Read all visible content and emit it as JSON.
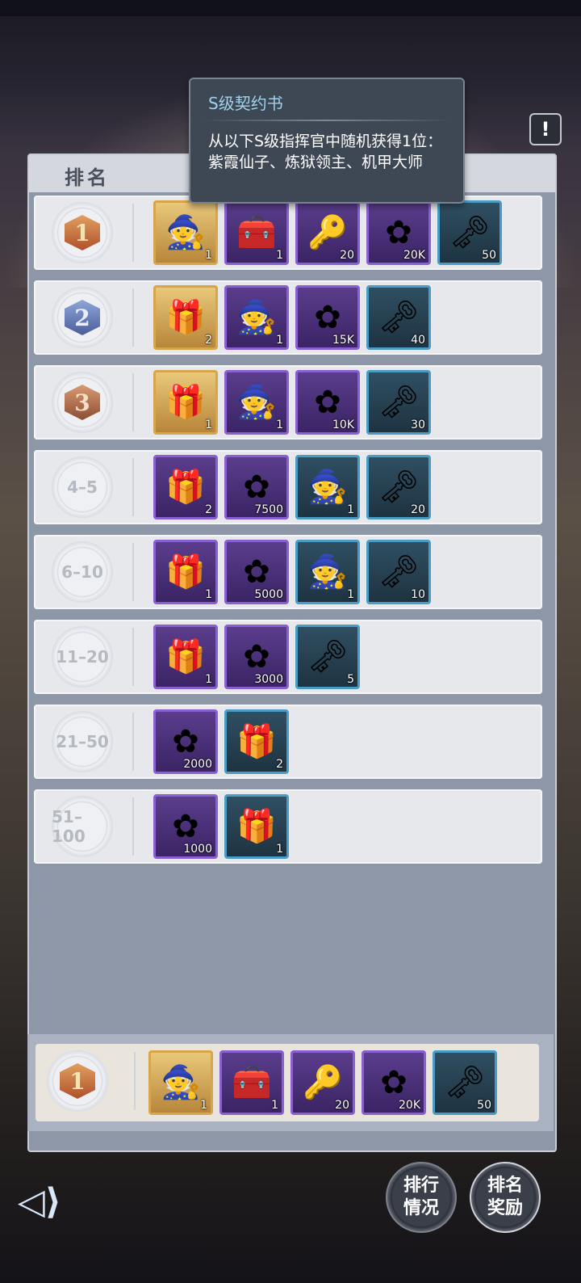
{
  "panel": {
    "header_label": "排名"
  },
  "tooltip": {
    "title": "S级契约书",
    "body": "从以下S级指挥官中随机获得1位：紫霞仙子、炼狱领主、机甲大师"
  },
  "info_button": "!",
  "rows": [
    {
      "rank": "1",
      "badge": "gold",
      "items": [
        {
          "icon": "wizard-hat-icon",
          "glyph": "🧙",
          "frame": "gold",
          "count": "1"
        },
        {
          "icon": "treasure-chest-icon",
          "glyph": "🧰",
          "frame": "purple",
          "count": "1"
        },
        {
          "icon": "gold-key-icon",
          "glyph": "🔑",
          "frame": "purple",
          "count": "20"
        },
        {
          "icon": "purple-flower-icon",
          "glyph": "✿",
          "frame": "purple",
          "count": "20K"
        },
        {
          "icon": "silver-key-icon",
          "glyph": "🗝",
          "frame": "blue",
          "count": "50"
        }
      ]
    },
    {
      "rank": "2",
      "badge": "blue",
      "items": [
        {
          "icon": "gold-gift-box-icon",
          "glyph": "🎁",
          "frame": "gold",
          "count": "2"
        },
        {
          "icon": "wizard-hat-icon",
          "glyph": "🧙",
          "frame": "purple",
          "count": "1"
        },
        {
          "icon": "purple-flower-icon",
          "glyph": "✿",
          "frame": "purple",
          "count": "15K"
        },
        {
          "icon": "silver-key-icon",
          "glyph": "🗝",
          "frame": "blue",
          "count": "40"
        }
      ]
    },
    {
      "rank": "3",
      "badge": "bronze",
      "items": [
        {
          "icon": "gold-gift-box-icon",
          "glyph": "🎁",
          "frame": "gold",
          "count": "1"
        },
        {
          "icon": "wizard-hat-icon",
          "glyph": "🧙",
          "frame": "purple",
          "count": "1"
        },
        {
          "icon": "purple-flower-icon",
          "glyph": "✿",
          "frame": "purple",
          "count": "10K"
        },
        {
          "icon": "silver-key-icon",
          "glyph": "🗝",
          "frame": "blue",
          "count": "30"
        }
      ]
    },
    {
      "rank": "4–5",
      "badge": "plain",
      "items": [
        {
          "icon": "pink-gift-box-icon",
          "glyph": "🎁",
          "frame": "purple",
          "count": "2"
        },
        {
          "icon": "purple-flower-icon",
          "glyph": "✿",
          "frame": "purple",
          "count": "7500"
        },
        {
          "icon": "blue-wizard-hat-icon",
          "glyph": "🧙",
          "frame": "blue",
          "count": "1"
        },
        {
          "icon": "silver-key-icon",
          "glyph": "🗝",
          "frame": "blue",
          "count": "20"
        }
      ]
    },
    {
      "rank": "6–10",
      "badge": "plain",
      "items": [
        {
          "icon": "pink-gift-box-icon",
          "glyph": "🎁",
          "frame": "purple",
          "count": "1"
        },
        {
          "icon": "purple-flower-icon",
          "glyph": "✿",
          "frame": "purple",
          "count": "5000"
        },
        {
          "icon": "blue-wizard-hat-icon",
          "glyph": "🧙",
          "frame": "blue",
          "count": "1"
        },
        {
          "icon": "silver-key-icon",
          "glyph": "🗝",
          "frame": "blue",
          "count": "10"
        }
      ]
    },
    {
      "rank": "11–20",
      "badge": "plain",
      "items": [
        {
          "icon": "pink-gift-box-icon",
          "glyph": "🎁",
          "frame": "purple",
          "count": "1"
        },
        {
          "icon": "purple-flower-icon",
          "glyph": "✿",
          "frame": "purple",
          "count": "3000"
        },
        {
          "icon": "silver-key-icon",
          "glyph": "🗝",
          "frame": "blue",
          "count": "5"
        }
      ]
    },
    {
      "rank": "21–50",
      "badge": "plain",
      "items": [
        {
          "icon": "purple-flower-icon",
          "glyph": "✿",
          "frame": "purple",
          "count": "2000"
        },
        {
          "icon": "blue-gift-box-icon",
          "glyph": "🎁",
          "frame": "blue",
          "count": "2"
        }
      ]
    },
    {
      "rank": "51–100",
      "badge": "plain",
      "items": [
        {
          "icon": "purple-flower-icon",
          "glyph": "✿",
          "frame": "purple",
          "count": "1000"
        },
        {
          "icon": "blue-gift-box-icon",
          "glyph": "🎁",
          "frame": "blue",
          "count": "1"
        }
      ]
    }
  ],
  "own_rank": {
    "rank": "1",
    "badge": "gold",
    "items": [
      {
        "icon": "wizard-hat-icon",
        "glyph": "🧙",
        "frame": "gold",
        "count": "1"
      },
      {
        "icon": "treasure-chest-icon",
        "glyph": "🧰",
        "frame": "purple",
        "count": "1"
      },
      {
        "icon": "gold-key-icon",
        "glyph": "🔑",
        "frame": "purple",
        "count": "20"
      },
      {
        "icon": "purple-flower-icon",
        "glyph": "✿",
        "frame": "purple",
        "count": "20K"
      },
      {
        "icon": "silver-key-icon",
        "glyph": "🗝",
        "frame": "blue",
        "count": "50"
      }
    ]
  },
  "buttons": {
    "ranking_status": "排行\n情况",
    "ranking_rewards": "排名\n奖励"
  }
}
